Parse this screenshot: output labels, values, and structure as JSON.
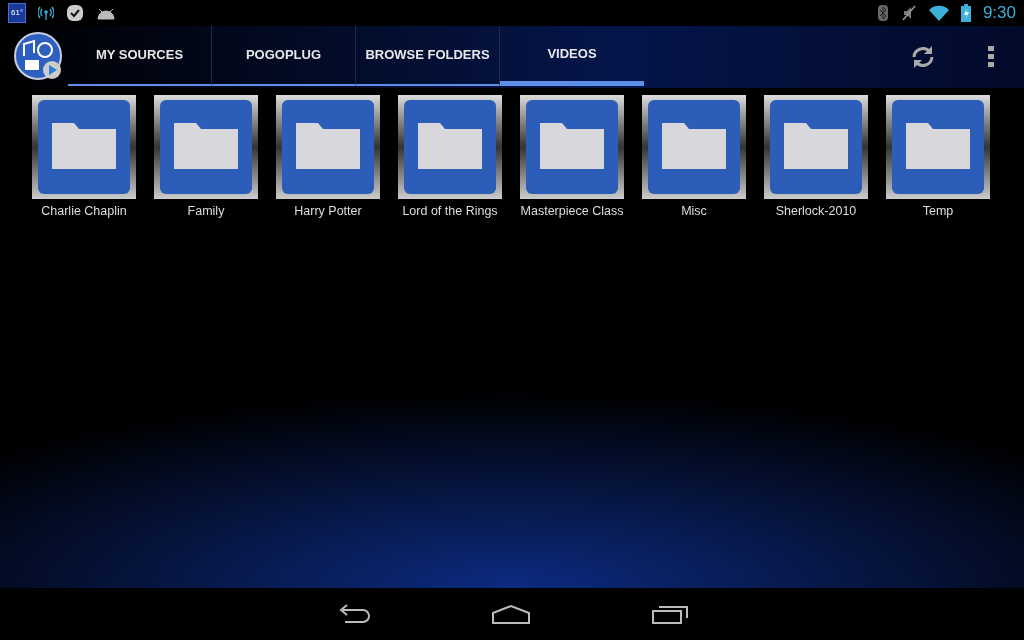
{
  "status_bar": {
    "weather": "61°",
    "time": "9:30"
  },
  "tabs": [
    {
      "label": "MY SOURCES",
      "selected": false
    },
    {
      "label": "POGOPLUG",
      "selected": false
    },
    {
      "label": "BROWSE FOLDERS",
      "selected": false
    },
    {
      "label": "VIDEOS",
      "selected": true
    }
  ],
  "folders": [
    {
      "name": "Charlie Chaplin"
    },
    {
      "name": "Family"
    },
    {
      "name": "Harry Potter"
    },
    {
      "name": "Lord of the Rings"
    },
    {
      "name": "Masterpiece Class"
    },
    {
      "name": "Misc"
    },
    {
      "name": "Sherlock-2010"
    },
    {
      "name": "Temp"
    }
  ]
}
